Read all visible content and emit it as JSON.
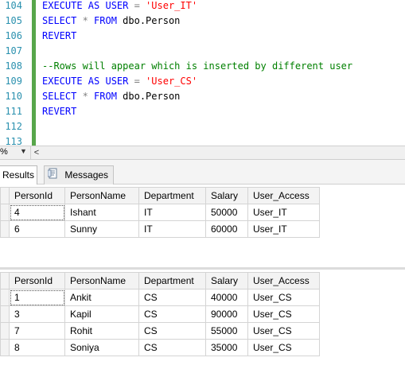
{
  "editor": {
    "line_numbers": [
      "104",
      "105",
      "106",
      "107",
      "108",
      "109",
      "110",
      "111",
      "112",
      "113"
    ],
    "lines": [
      {
        "parts": [
          {
            "t": "EXECUTE AS USER ",
            "c": "kw"
          },
          {
            "t": "= ",
            "c": "gray"
          },
          {
            "t": "'User_IT'",
            "c": "str"
          }
        ]
      },
      {
        "parts": [
          {
            "t": "SELECT ",
            "c": "kw"
          },
          {
            "t": "* ",
            "c": "gray"
          },
          {
            "t": "FROM ",
            "c": "kw"
          },
          {
            "t": "dbo.Person",
            "c": ""
          }
        ]
      },
      {
        "parts": [
          {
            "t": "REVERT",
            "c": "kw"
          }
        ]
      },
      {
        "parts": []
      },
      {
        "parts": [
          {
            "t": "--Rows will appear which is inserted by different user",
            "c": "cmt"
          }
        ]
      },
      {
        "parts": [
          {
            "t": "EXECUTE AS USER ",
            "c": "kw"
          },
          {
            "t": "= ",
            "c": "gray"
          },
          {
            "t": "'User_CS'",
            "c": "str"
          }
        ]
      },
      {
        "parts": [
          {
            "t": "SELECT ",
            "c": "kw"
          },
          {
            "t": "* ",
            "c": "gray"
          },
          {
            "t": "FROM ",
            "c": "kw"
          },
          {
            "t": "dbo.Person",
            "c": ""
          }
        ]
      },
      {
        "parts": [
          {
            "t": "REVERT",
            "c": "kw"
          }
        ]
      },
      {
        "parts": []
      },
      {
        "parts": []
      }
    ]
  },
  "zoom": {
    "label": "%",
    "caret": "▼",
    "scroll_left": "<"
  },
  "tabs": {
    "results": "Results",
    "messages": "Messages"
  },
  "grid1": {
    "headers": [
      "PersonId",
      "PersonName",
      "Department",
      "Salary",
      "User_Access"
    ],
    "rows": [
      [
        "4",
        "Ishant",
        "IT",
        "50000",
        "User_IT"
      ],
      [
        "6",
        "Sunny",
        "IT",
        "60000",
        "User_IT"
      ]
    ]
  },
  "grid2": {
    "headers": [
      "PersonId",
      "PersonName",
      "Department",
      "Salary",
      "User_Access"
    ],
    "rows": [
      [
        "1",
        "Ankit",
        "CS",
        "40000",
        "User_CS"
      ],
      [
        "3",
        "Kapil",
        "CS",
        "90000",
        "User_CS"
      ],
      [
        "7",
        "Rohit",
        "CS",
        "55000",
        "User_CS"
      ],
      [
        "8",
        "Soniya",
        "CS",
        "35000",
        "User_CS"
      ]
    ]
  },
  "colors": {
    "keyword": "#0000ff",
    "string": "#ff0000",
    "comment": "#008000",
    "line_number": "#2b91af",
    "change_bar": "#57a64a"
  }
}
